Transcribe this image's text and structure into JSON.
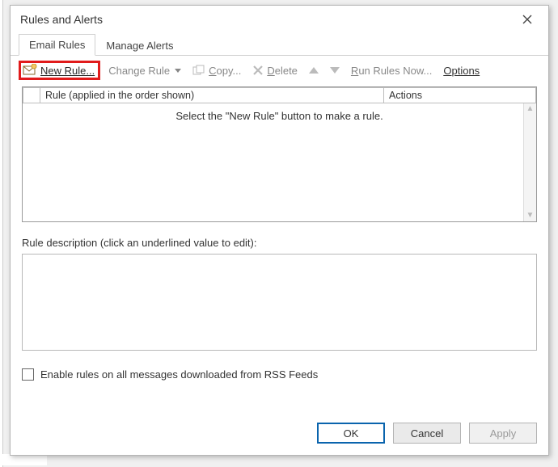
{
  "dialog": {
    "title": "Rules and Alerts"
  },
  "tabs": {
    "email_rules": "Email Rules",
    "manage_alerts": "Manage Alerts"
  },
  "toolbar": {
    "new_rule": "New Rule...",
    "change_rule": "Change Rule",
    "copy": "Copy...",
    "delete": "Delete",
    "run_rules_now": "Run Rules Now...",
    "options": "Options"
  },
  "grid": {
    "col_rule": "Rule (applied in the order shown)",
    "col_actions": "Actions",
    "empty_msg": "Select the \"New Rule\" button to make a rule."
  },
  "description": {
    "label": "Rule description (click an underlined value to edit):"
  },
  "rss": {
    "label": "Enable rules on all messages downloaded from RSS Feeds"
  },
  "buttons": {
    "ok": "OK",
    "cancel": "Cancel",
    "apply": "Apply"
  }
}
